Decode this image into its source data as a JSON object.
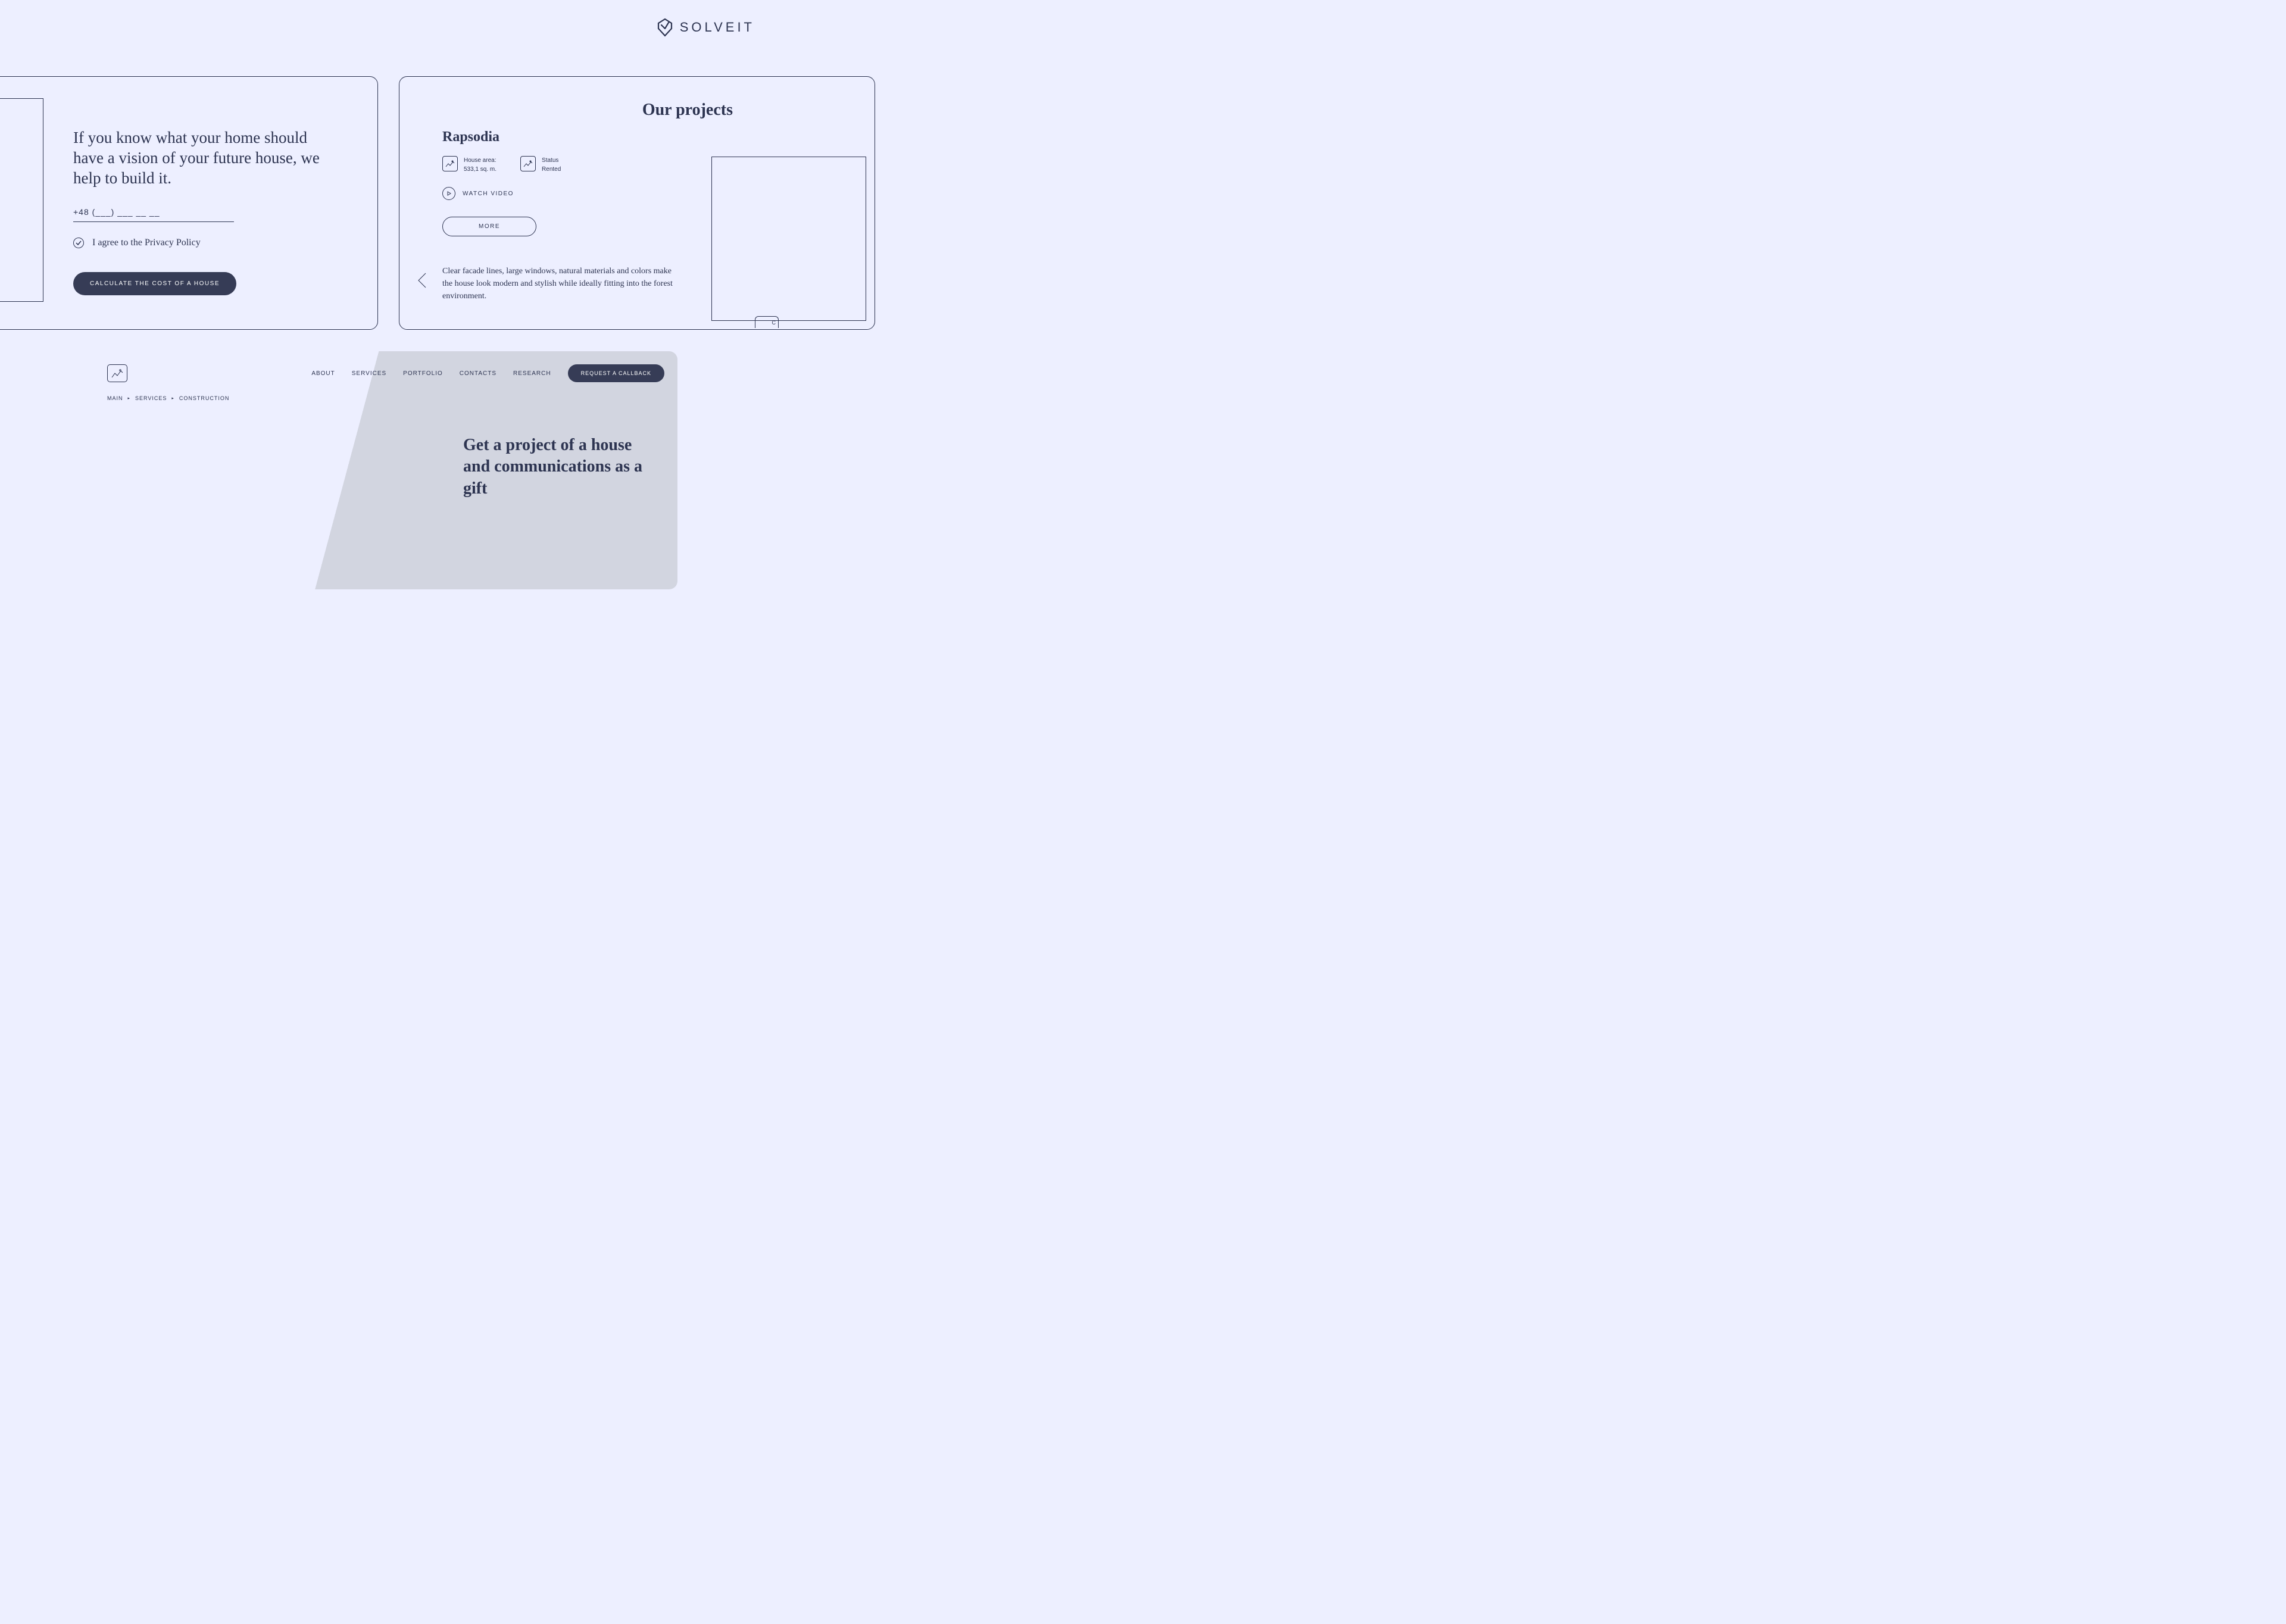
{
  "brand": {
    "name": "SOLVEIT"
  },
  "left_frame": {
    "headline": "If you know what your home should have a vision of your future house, we help to build it.",
    "phone_placeholder": "+48 (___) ___ __ __",
    "privacy_text": "I agree to the Privacy Policy",
    "cta_button": "CALCULATE THE COST OF A HOUSE"
  },
  "right_frame": {
    "section_title": "Our projects",
    "project_name": "Rapsodia",
    "area_label": "House area:",
    "area_value": "533,1 sq. m.",
    "status_label": "Status",
    "status_value": "Rented",
    "watch_video": "WATCH VIDEO",
    "more_button": "MORE",
    "description": "Clear facade lines, large windows, natural materials and colors make the house look modern and stylish while ideally fitting into the forest environment.",
    "small_box_text": "C"
  },
  "bottom_frame": {
    "nav": {
      "about": "ABOUT",
      "services": "SERVICES",
      "portfolio": "PORTFOLIO",
      "contacts": "CONTACTS",
      "research": "RESEARCH"
    },
    "callback_button": "REQUEST A CALLBACK",
    "breadcrumb": {
      "main": "MAIN",
      "services": "SERVICES",
      "construction": "CONSTRUCTION"
    },
    "hero": "Get a project of a house and communications as a gift"
  }
}
